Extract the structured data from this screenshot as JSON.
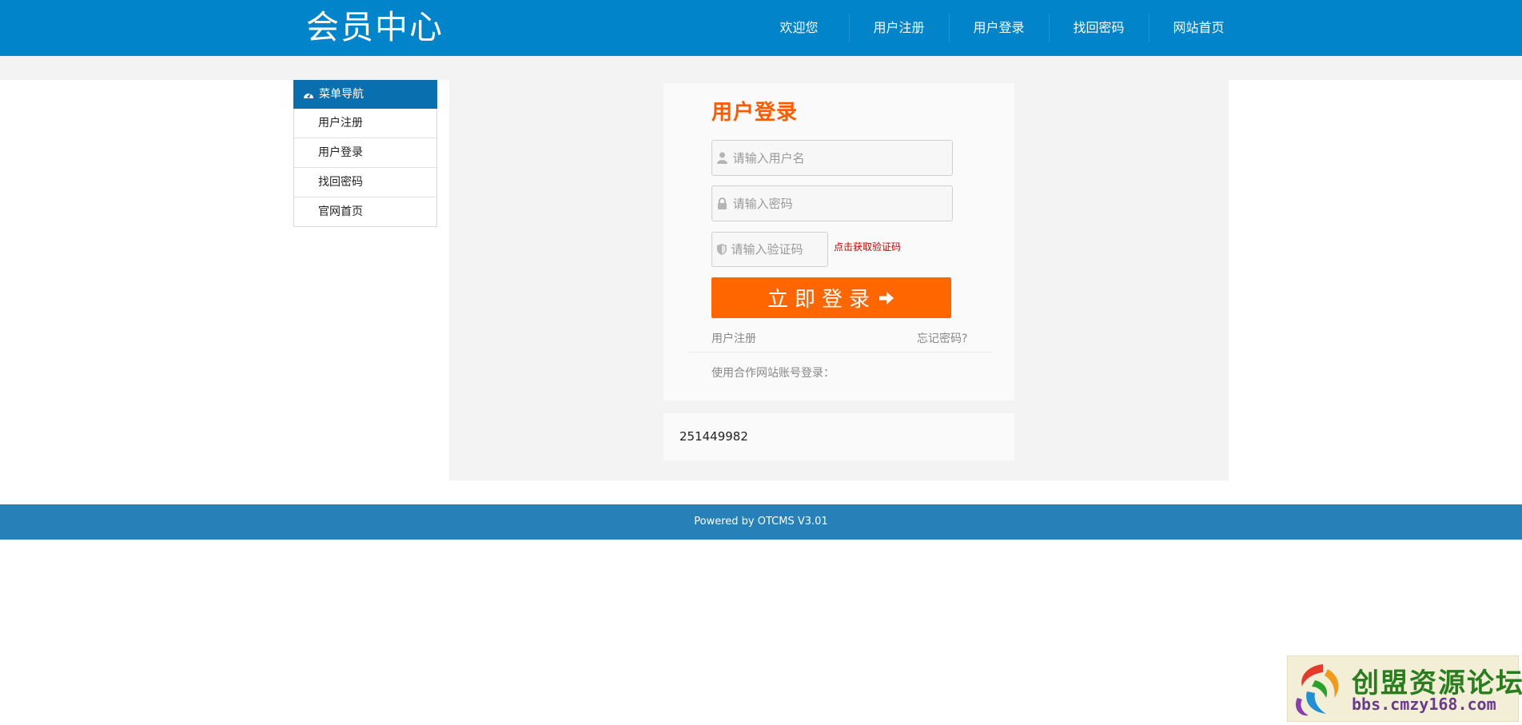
{
  "header": {
    "title": "会员中心",
    "nav": [
      "欢迎您",
      "用户注册",
      "用户登录",
      "找回密码",
      "网站首页"
    ]
  },
  "sidebar": {
    "title": "菜单导航",
    "items": [
      {
        "label": "用户注册"
      },
      {
        "label": "用户登录"
      },
      {
        "label": "找回密码"
      },
      {
        "label": "官网首页"
      }
    ]
  },
  "login": {
    "title": "用户登录",
    "username_placeholder": "请输入用户名",
    "password_placeholder": "请输入密码",
    "captcha_placeholder": "请输入验证码",
    "captcha_link": "点击获取验证码",
    "submit_label": "立即登录",
    "register_link": "用户注册",
    "forgot_link": "忘记密码?",
    "partner_text": "使用合作网站账号登录："
  },
  "qq_box": {
    "text": "251449982"
  },
  "footer": {
    "text": "Powered by OTCMS V3.01"
  },
  "watermark": {
    "title": "创盟资源论坛",
    "url": "bbs.cmzy168.com"
  },
  "colors": {
    "header_bg": "#0284cb",
    "sidebar_head_bg": "#0a6fae",
    "accent": "#ff6600",
    "title_orange": "#ff5a00",
    "footer_bg": "#2780b8",
    "captcha_link": "#cc0000"
  }
}
